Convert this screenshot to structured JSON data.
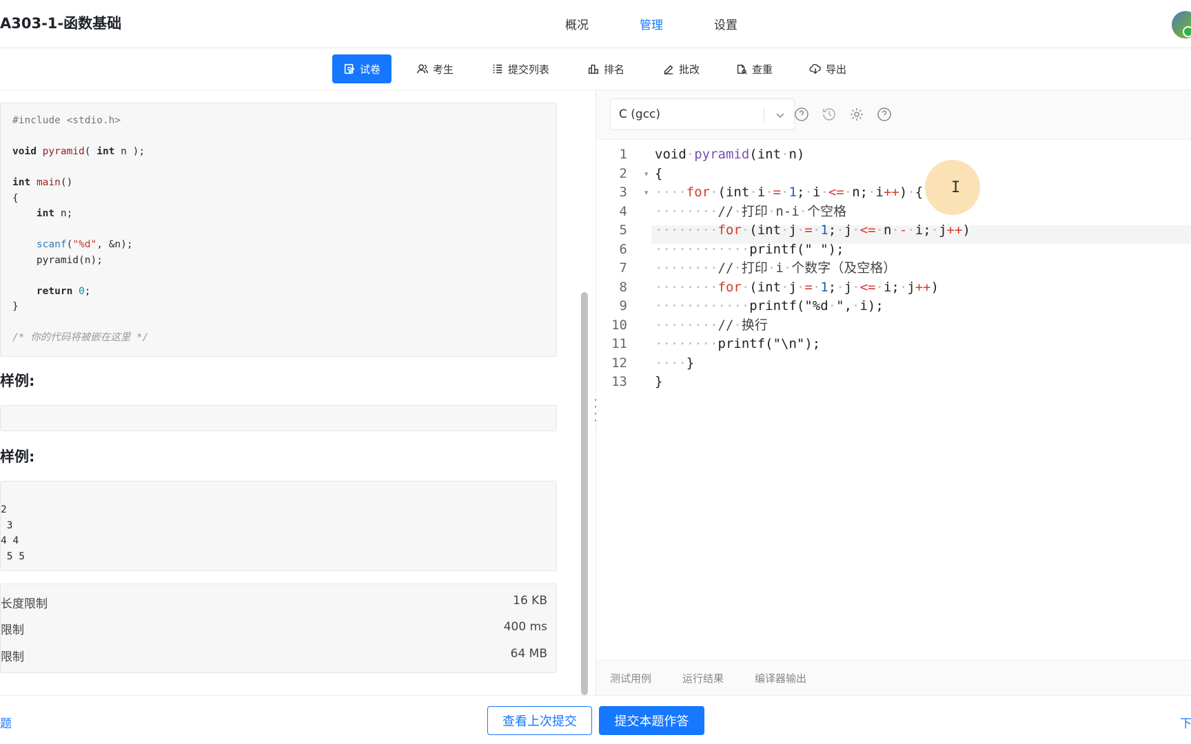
{
  "header": {
    "title": "A303-1-函数基础",
    "nav": [
      {
        "label": "概况"
      },
      {
        "label": "管理"
      },
      {
        "label": "设置"
      }
    ],
    "active_nav": "管理"
  },
  "toolbar": {
    "items": [
      {
        "label": "试卷",
        "icon": "edit-icon"
      },
      {
        "label": "考生",
        "icon": "users-icon"
      },
      {
        "label": "提交列表",
        "icon": "list-icon"
      },
      {
        "label": "排名",
        "icon": "bar-chart-icon"
      },
      {
        "label": "批改",
        "icon": "pen-icon"
      },
      {
        "label": "查重",
        "icon": "check-duplicate-icon"
      },
      {
        "label": "导出",
        "icon": "cloud-download-icon"
      }
    ],
    "active": "试卷"
  },
  "problem": {
    "sample_input_heading": "样例:",
    "sample_output_heading": "样例:",
    "sample_output_lines": [
      "2",
      " 3",
      "4 4",
      " 5 5"
    ],
    "limits": [
      {
        "label": "长度限制",
        "value": "16 KB"
      },
      {
        "label": "限制",
        "value": "400 ms"
      },
      {
        "label": "限制",
        "value": "64 MB"
      }
    ]
  },
  "editor": {
    "language": "C (gcc)",
    "line_count": 13,
    "result_tabs": [
      "测试用例",
      "运行结果",
      "编译器输出"
    ]
  },
  "footer": {
    "left_link": "题",
    "right_link": "下",
    "view_last_label": "查看上次提交",
    "submit_label": "提交本题作答"
  }
}
